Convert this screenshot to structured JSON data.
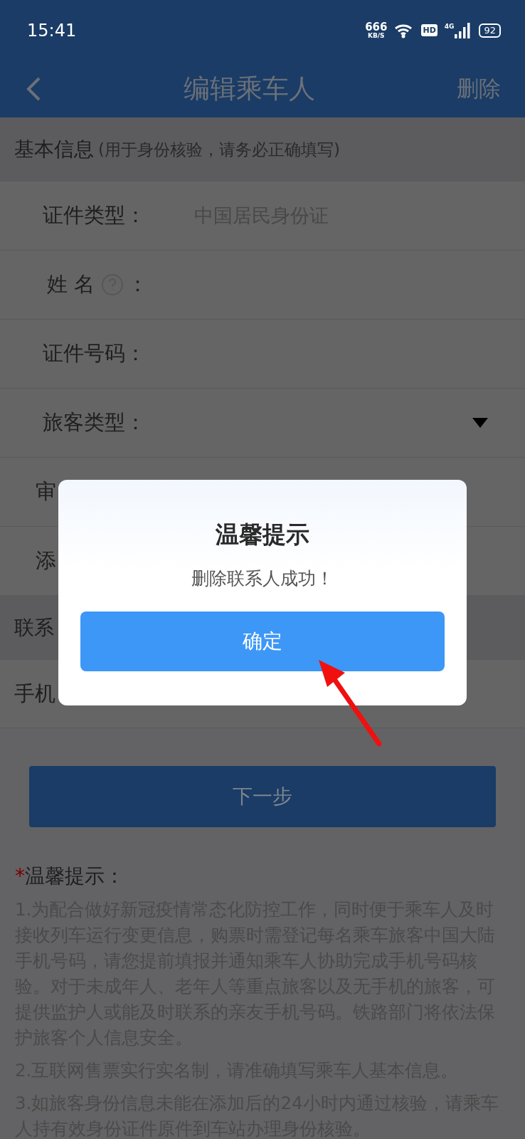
{
  "status_bar": {
    "time": "15:41",
    "speed_value": "666",
    "speed_unit": "KB/S",
    "hd": "HD",
    "network": "4G",
    "battery": "92"
  },
  "header": {
    "title": "编辑乘车人",
    "action": "删除"
  },
  "sections": [
    {
      "title": "基本信息",
      "note": "(用于身份核验，请务必正确填写)",
      "rows": [
        {
          "kind": "value",
          "label": "证件类型：",
          "value": "中国居民身份证"
        },
        {
          "kind": "help",
          "label": "姓 名",
          "suffix": "："
        },
        {
          "kind": "plain",
          "label": "证件号码："
        },
        {
          "kind": "select",
          "label": "旅客类型："
        },
        {
          "kind": "partial",
          "label": "审"
        },
        {
          "kind": "partial",
          "label": "添"
        }
      ]
    },
    {
      "title": "联系",
      "rows": [
        {
          "kind": "short",
          "label": "手机"
        }
      ]
    }
  ],
  "next_button": "下一步",
  "tips": {
    "star": "*",
    "title": "温馨提示：",
    "paragraphs": [
      "1.为配合做好新冠疫情常态化防控工作，同时便于乘车人及时接收列车运行变更信息，购票时需登记每名乘车旅客中国大陆手机号码，请您提前填报并通知乘车人协助完成手机号码核验。对于未成年人、老年人等重点旅客以及无手机的旅客，可提供监护人或能及时联系的亲友手机号码。铁路部门将依法保护旅客个人信息安全。",
      "2.互联网售票实行实名制，请准确填写乘车人基本信息。",
      "3.如旅客身份信息未能在添加后的24小时内通过核验，请乘车人持有效身份证件原件到车站办理身份核验。"
    ]
  },
  "dialog": {
    "title": "温馨提示",
    "message": "删除联系人成功！",
    "button": "确定"
  }
}
